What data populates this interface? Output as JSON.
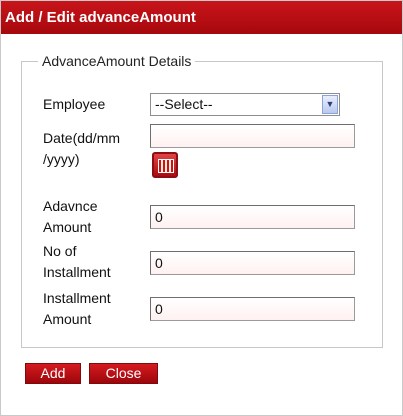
{
  "dialog": {
    "title": "Add / Edit advanceAmount"
  },
  "form": {
    "legend": "AdvanceAmount Details",
    "employee": {
      "label": "Employee",
      "selected": "--Select--"
    },
    "date": {
      "label_line1": "Date(dd/mm",
      "label_line2": "/yyyy)",
      "value": ""
    },
    "advance_amount": {
      "label_line1": "Adavnce",
      "label_line2": "Amount",
      "value": "0"
    },
    "installments": {
      "label_line1": "No of",
      "label_line2": "Installment",
      "value": "0"
    },
    "installment_amount": {
      "label_line1": "Installment",
      "label_line2": "Amount",
      "value": "0"
    }
  },
  "buttons": {
    "add": "Add",
    "close": "Close"
  },
  "icons": {
    "calendar": "calendar-icon",
    "dropdown": "chevron-down-icon"
  },
  "colors": {
    "accent": "#b30f14",
    "input_bg": "#fff1f1"
  }
}
